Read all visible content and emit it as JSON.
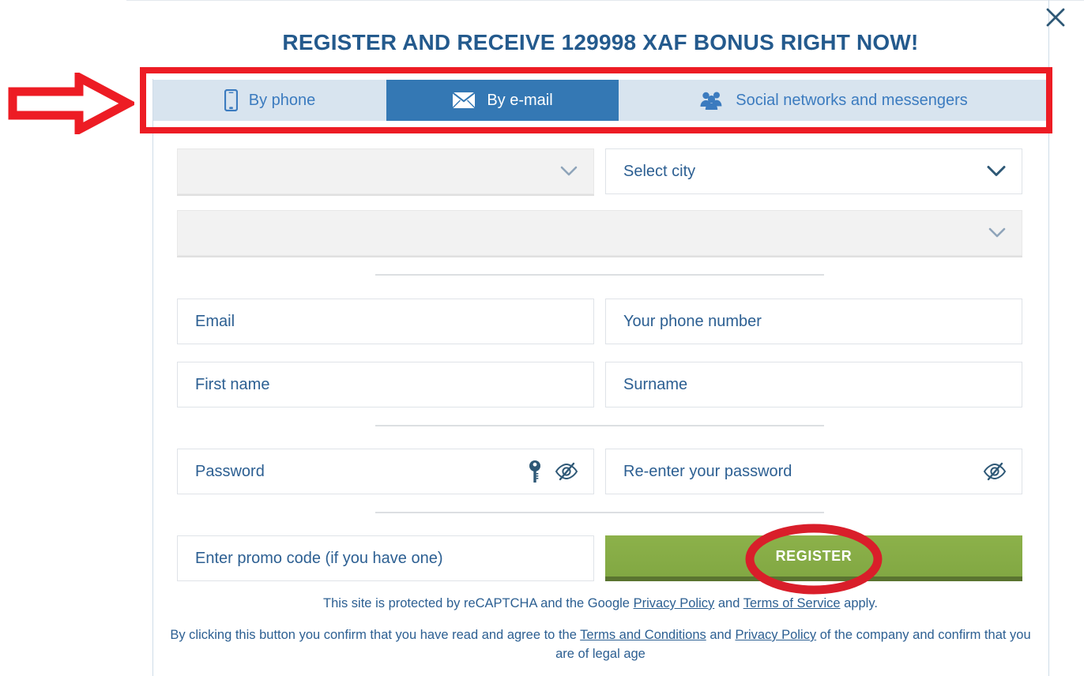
{
  "window": {
    "close_icon": "close-icon"
  },
  "header": {
    "title": "REGISTER AND RECEIVE 129998 XAF BONUS RIGHT NOW!",
    "title_color": "#245a8d"
  },
  "tabs": [
    {
      "id": "by-phone",
      "label": "By phone",
      "icon": "phone-icon",
      "active": false
    },
    {
      "id": "by-email",
      "label": "By e-mail",
      "icon": "envelope-icon",
      "active": true
    },
    {
      "id": "by-social",
      "label": "Social networks and messengers",
      "icon": "people-icon",
      "active": false
    }
  ],
  "form": {
    "country_select": {
      "value": "",
      "disabled": true,
      "icon": "chevron-down-icon"
    },
    "city_select": {
      "value": "Select city",
      "disabled": false,
      "icon": "chevron-down-icon"
    },
    "currency_select": {
      "value": "",
      "disabled": true,
      "icon": "chevron-down-icon"
    },
    "email": {
      "placeholder": "Email",
      "value": ""
    },
    "phone": {
      "placeholder": "Your phone number",
      "value": ""
    },
    "first_name": {
      "placeholder": "First name",
      "value": ""
    },
    "surname": {
      "placeholder": "Surname",
      "value": ""
    },
    "password": {
      "placeholder": "Password",
      "value": "",
      "icons": [
        "key-icon",
        "eye-slash-icon"
      ]
    },
    "password_confirm": {
      "placeholder": "Re-enter your password",
      "value": "",
      "icons": [
        "eye-slash-icon"
      ]
    },
    "promo_code": {
      "placeholder": "Enter promo code (if you have one)",
      "value": ""
    },
    "register_button": {
      "label": "REGISTER",
      "color": "#86ad47"
    }
  },
  "legal": {
    "recaptcha": {
      "prefix": "This site is protected by reCAPTCHA and the Google ",
      "link1": "Privacy Policy",
      "middle": " and ",
      "link2": "Terms of Service",
      "suffix": " apply."
    },
    "terms": {
      "prefix": "By clicking this button you confirm that you have read and agree to the ",
      "link1": "Terms and Conditions",
      "middle": " and ",
      "link2": "Privacy Policy",
      "suffix": " of the company and confirm that you are of legal age"
    }
  },
  "annotations": {
    "color": "#ed1c24",
    "arrow": "right-arrow-annotation",
    "box": "tab-bar-highlight-box",
    "ellipse": "register-button-highlight-ellipse"
  }
}
